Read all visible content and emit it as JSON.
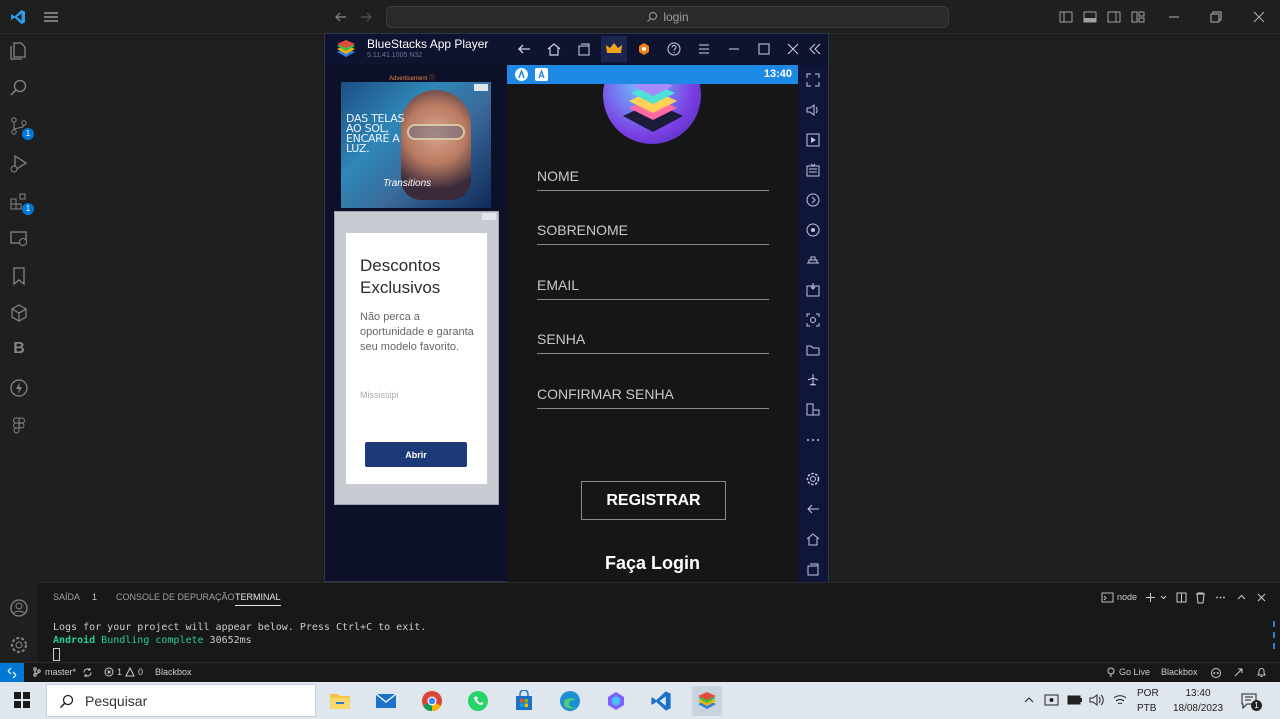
{
  "titlebar": {
    "search_placeholder": "login"
  },
  "activity": {
    "scm_badge": "1",
    "extensions_badge": "1",
    "b_label": "B"
  },
  "bluestacks": {
    "title": "BlueStacks App Player",
    "version": "5.11.41.1005 N32",
    "ad_label": "Advertisement ⓘ",
    "ad1_text": "DAS TELAS AO SOL, ENCARE A LUZ.",
    "ad1_brand": "Transitions",
    "ad2": {
      "title": "Descontos Exclusivos",
      "body": "Não perca a oportunidade e garanta seu modelo favorito.",
      "source": "Mississipi",
      "button": "Abrir"
    }
  },
  "android": {
    "time": "13:40",
    "fields": [
      "NOME",
      "SOBRENOME",
      "EMAIL",
      "SENHA",
      "CONFIRMAR SENHA"
    ],
    "register_button": "REGISTRAR",
    "login_link": "Faça Login"
  },
  "panel": {
    "tabs": {
      "output": "SAÍDA",
      "output_count": "1",
      "debug": "CONSOLE DE DEPURAÇÃO",
      "terminal": "TERMINAL"
    },
    "shell": "node",
    "lines": {
      "l1": "Logs for your project will appear below. Press Ctrl+C to exit.",
      "l2_green": "Android",
      "l2_green2": " Bundling complete",
      "l2_rest": " 30652ms"
    }
  },
  "statusbar": {
    "branch": "master*",
    "errors": "1",
    "warnings": "0",
    "blackbox_left": "Blackbox",
    "go_live": "Go Live",
    "blackbox_right": "Blackbox"
  },
  "taskbar": {
    "search": "Pesquisar",
    "lang": "POR",
    "layout": "PTB",
    "time": "13:40",
    "date": "18/08/2023",
    "notif_count": "1"
  }
}
